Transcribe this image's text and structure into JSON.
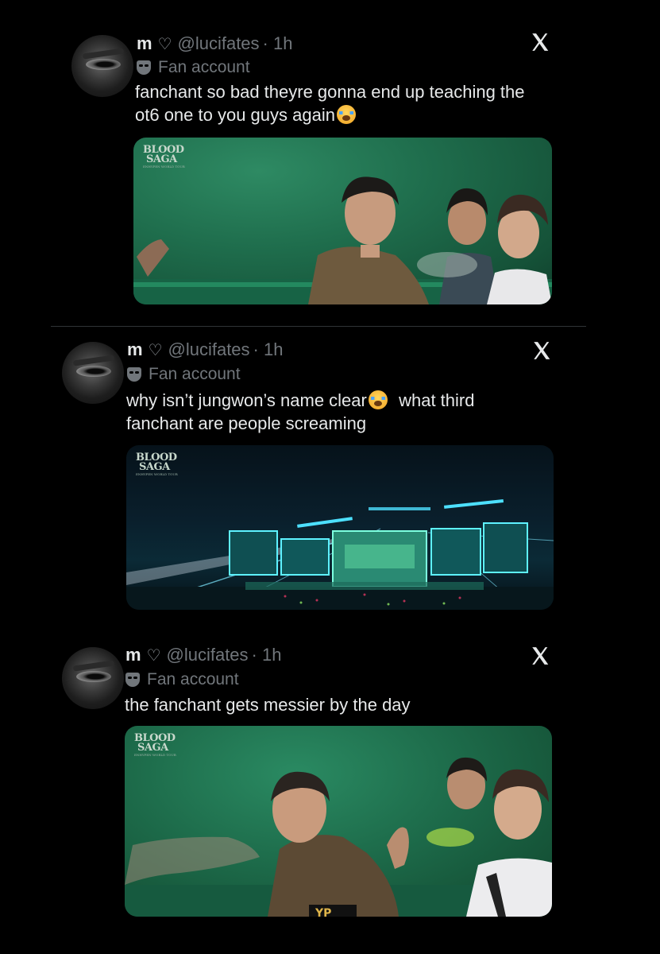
{
  "tweets": [
    {
      "name": "m",
      "heart": "♡",
      "handle": "@lucifates",
      "time": "· 1h",
      "label": "Fan account",
      "text_line1": "fanchant so bad theyre gonna end up teaching the",
      "text_line2": "ot6 one to you guys again",
      "media_logo": "BLOOD SAGA",
      "icon": "x-logo-icon"
    },
    {
      "name": "m",
      "heart": "♡",
      "handle": "@lucifates",
      "time": "· 1h",
      "label": "Fan account",
      "text_line1a": "why isn’t jungwon’s name clear",
      "text_line1b": "what third",
      "text_line2": "fanchant are people screaming",
      "media_logo": "BLOOD SAGA",
      "icon": "x-logo-icon"
    },
    {
      "name": "m",
      "heart": "♡",
      "handle": "@lucifates",
      "time": "· 1h",
      "label": "Fan account",
      "text_line1": "the fanchant gets messier by the day",
      "media_logo": "BLOOD SAGA",
      "icon": "x-logo-icon"
    }
  ],
  "colors": {
    "background": "#000000",
    "text": "#e7e9ea",
    "muted": "#71767b",
    "stage_green": "#1d6b48"
  }
}
